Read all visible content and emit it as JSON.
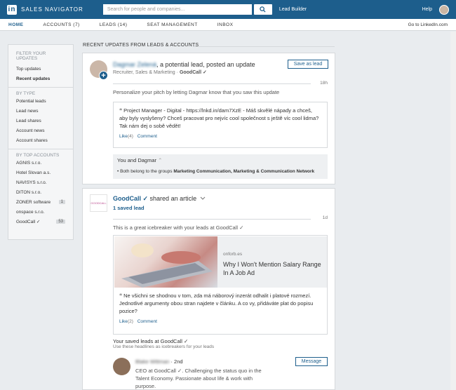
{
  "header": {
    "logo_mark": "in",
    "brand": "SALES NAVIGATOR",
    "search_placeholder": "Search for people and companies...",
    "lead_builder": "Lead Builder",
    "help": "Help"
  },
  "nav": {
    "items": [
      "HOME",
      "ACCOUNTS (7)",
      "LEADS (14)",
      "SEAT MANAGEMENT",
      "INBOX"
    ],
    "right": "Go to LinkedIn.com"
  },
  "sidebar": {
    "filter_head": "FILTER YOUR UPDATES",
    "filters": [
      "Top updates",
      "Recent updates"
    ],
    "type_head": "BY TYPE",
    "types": [
      "Potential leads",
      "Lead news",
      "Lead shares",
      "Account news",
      "Account shares"
    ],
    "accounts_head": "BY TOP ACCOUNTS",
    "accounts": [
      {
        "name": "AGNIS s.r.o.",
        "count": ""
      },
      {
        "name": "Hotel Slovan a.s.",
        "count": ""
      },
      {
        "name": "NAVISYS s.r.o.",
        "count": ""
      },
      {
        "name": "DITON s.r.o.",
        "count": ""
      },
      {
        "name": "ZONER software",
        "count": "1"
      },
      {
        "name": "onspace s.r.o.",
        "count": ""
      },
      {
        "name": "GoodCall ✓",
        "count": "53"
      }
    ]
  },
  "main": {
    "heading": "RECENT UPDATES FROM LEADS & ACCOUNTS",
    "card1": {
      "name": "Dagmar Zelená",
      "title_rest": ", a potential lead, posted an update",
      "role": "Recruiter, Sales & Marketing · ",
      "company": "GoodCall ✓",
      "save_btn": "Save as lead",
      "age": "18h",
      "personalize": "Personalize your pitch by letting Dagmar know that you saw this update",
      "quote_mark": "❝",
      "quote": "Project Manager - Digital - https://lnkd.in/dam7XzE - Máš skvělé nápady a chceš, aby byly vyslyšeny? Chceš pracovat pro nejvíc cool společnost s ještě víc cool lidma? Tak nám dej o sobě vědět!",
      "like": "Like",
      "like_count": "(4)",
      "comment": "Comment",
      "you_and": "You and Dagmar",
      "common_prefix": "Both belong to the groups ",
      "common_groups": "Marketing Communication, Marketing & Communication Network"
    },
    "card2": {
      "logo_text": "GOODCALL",
      "company": "GoodCall ✓",
      "action": " shared an article",
      "saved": "1 saved lead",
      "age": "1d",
      "icebreaker": "This is a great icebreaker with your leads at GoodCall ✓",
      "article_source": "onforb.es",
      "article_title": "Why I Won't Mention Salary Range In A Job Ad",
      "quote_mark": "❝",
      "article_text": "Ne všichni se shodnou v tom, zda má náborový inzerát odhalit i platové rozmezí. Jednotlivé argumenty obou stran najdete v článku. A co vy, přidáváte plat do popisu pozice?",
      "like": "Like",
      "like_count": "(2)",
      "comment": "Comment",
      "saved_leads_title": "Your saved leads at GoodCall ✓",
      "saved_leads_sub": "Use these headlines as icebreakers for your leads",
      "lead_name": "Blake Wittman",
      "lead_degree": " · 2nd",
      "lead_desc": "CEO at GoodCall ✓. Challenging the status quo in the Talent Economy. Passionate about life & work with purpose.",
      "message_btn": "Message"
    }
  },
  "colors": {
    "brand": "#1d5e8c",
    "bg": "#e9ecef"
  },
  "icons": [
    "linkedin-logo-icon",
    "search-icon",
    "plus-icon",
    "chevron-down-icon",
    "quote-icon"
  ]
}
